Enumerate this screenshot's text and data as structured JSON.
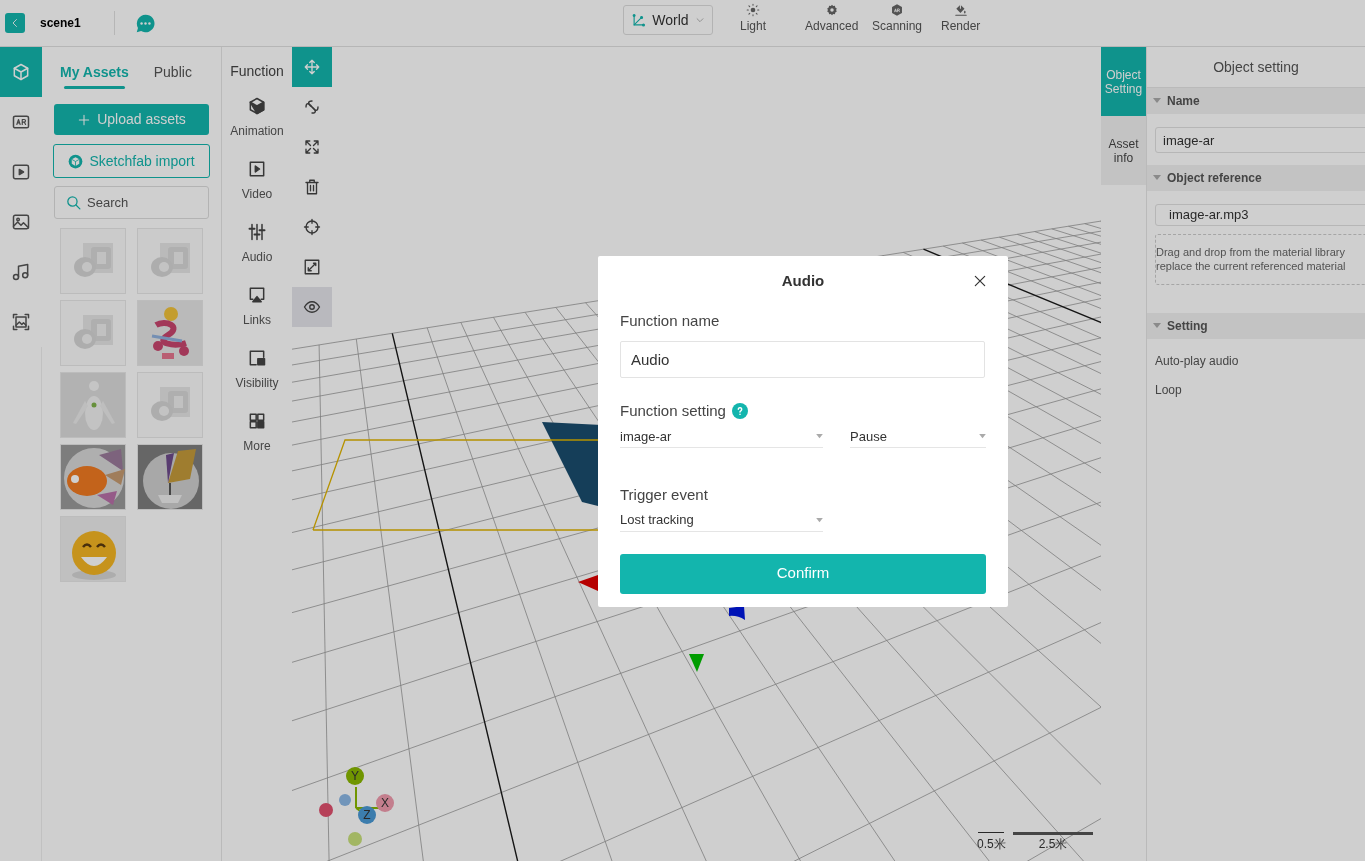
{
  "header": {
    "title": "scene1",
    "coordinate_mode": "World",
    "tools": [
      {
        "label": "Light"
      },
      {
        "label": "Advanced"
      },
      {
        "label": "Scanning"
      },
      {
        "label": "Render"
      }
    ]
  },
  "left_rail": [
    {
      "selected": true
    },
    {
      "selected": false
    },
    {
      "selected": false
    },
    {
      "selected": false
    },
    {
      "selected": false
    },
    {
      "selected": false
    }
  ],
  "assets": {
    "tabs": [
      {
        "label": "My Assets",
        "selected": true
      },
      {
        "label": "Public",
        "selected": false
      }
    ],
    "upload_button": "Upload assets",
    "import_button": "Sketchfab import",
    "search": {
      "placeholder": "Search"
    }
  },
  "functions": {
    "title": "Function",
    "items": [
      {
        "label": "Animation"
      },
      {
        "label": "Video"
      },
      {
        "label": "Audio"
      },
      {
        "label": "Links"
      },
      {
        "label": "Visibility"
      },
      {
        "label": "More"
      }
    ]
  },
  "tools": [
    {
      "selected": true,
      "hovered": false
    },
    {
      "selected": false,
      "hovered": false
    },
    {
      "selected": false,
      "hovered": false
    },
    {
      "selected": false,
      "hovered": false
    },
    {
      "selected": false,
      "hovered": false
    },
    {
      "selected": false,
      "hovered": false
    },
    {
      "selected": false,
      "hovered": true
    }
  ],
  "viewport": {
    "axes": [
      "Y",
      "X",
      "Z"
    ],
    "scales": [
      "0.5米",
      "2.5米"
    ]
  },
  "right_tabs": [
    {
      "label": "Object Setting",
      "selected": true
    },
    {
      "label": "Asset info",
      "selected": false
    }
  ],
  "settings": {
    "title": "Object setting",
    "sections": [
      {
        "title": "Name",
        "expanded": true,
        "field": "image-ar"
      },
      {
        "title": "Object reference",
        "expanded": true,
        "field": "image-ar.mp3",
        "drop_hint": [
          "Drag and drop from the material library",
          "replace the current referenced material"
        ]
      },
      {
        "title": "Setting",
        "expanded": true,
        "rows": [
          "Auto-play audio",
          "Loop"
        ]
      }
    ]
  },
  "dialog": {
    "title": "Audio",
    "function_name_label": "Function name",
    "function_name": "Audio",
    "function_setting_label": "Function setting",
    "function_setting": [
      "image-ar",
      "Pause"
    ],
    "trigger_event_label": "Trigger event",
    "trigger_event": "Lost tracking",
    "confirm": "Confirm"
  }
}
